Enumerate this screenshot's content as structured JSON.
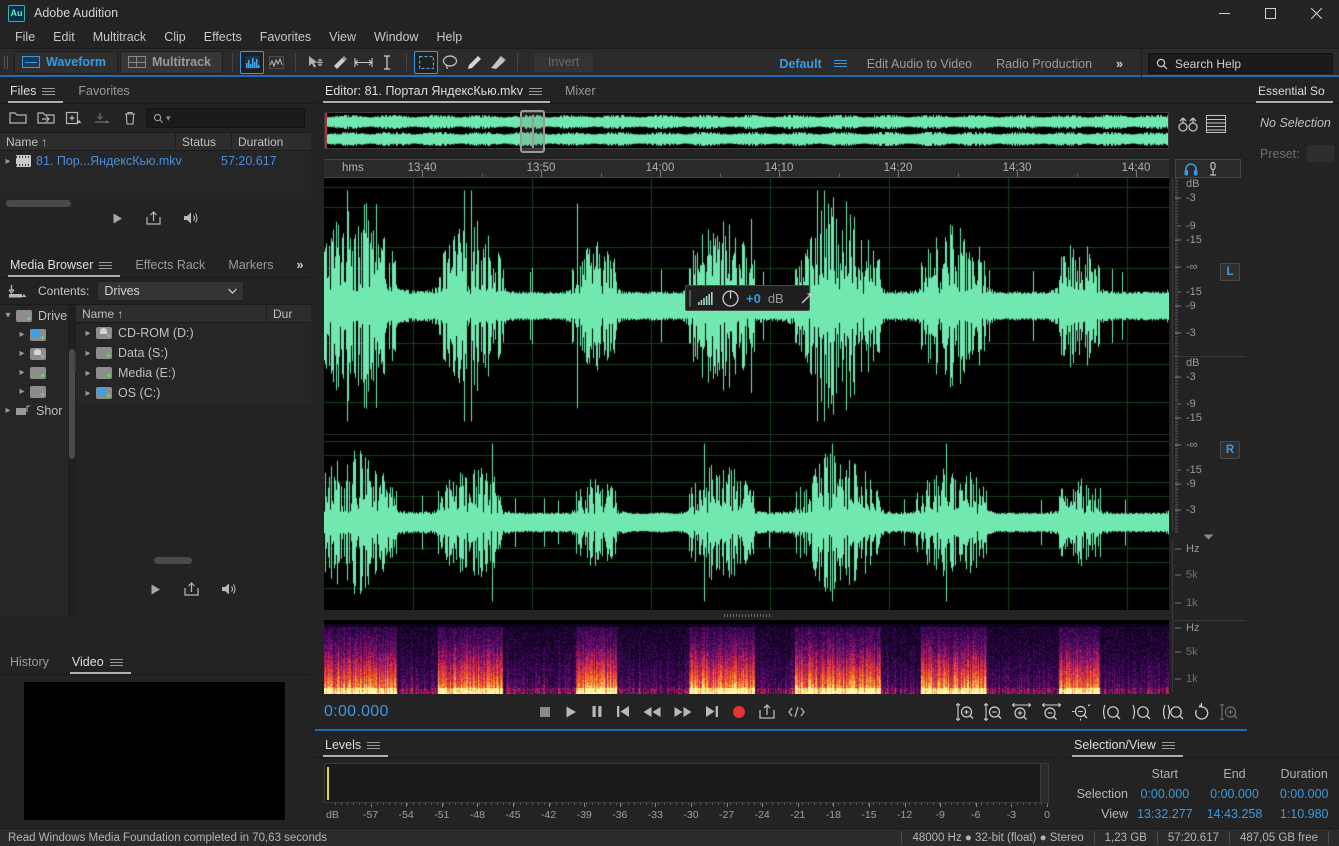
{
  "window": {
    "app_name": "Adobe Audition",
    "logo_text": "Au",
    "minimize": "─",
    "maximize": "□",
    "close": "✕"
  },
  "menubar": {
    "items": [
      "File",
      "Edit",
      "Multitrack",
      "Clip",
      "Effects",
      "Favorites",
      "View",
      "Window",
      "Help"
    ]
  },
  "toolbar": {
    "waveform_label": "Waveform",
    "multitrack_label": "Multitrack",
    "invert_label": "Invert",
    "workspaces": [
      {
        "label": "Default",
        "active": true
      },
      {
        "label": "Edit Audio to Video",
        "active": false
      },
      {
        "label": "Radio Production",
        "active": false
      }
    ],
    "more_label": "»",
    "search_placeholder": "Search Help"
  },
  "files_panel": {
    "tabs": [
      {
        "label": "Files",
        "active": true,
        "menu": true
      },
      {
        "label": "Favorites",
        "active": false,
        "menu": false
      }
    ],
    "search_placeholder": "",
    "columns": [
      "Name ↑",
      "Status",
      "Duration"
    ],
    "rows": [
      {
        "name": "81. Пор...ЯндексКью.mkv",
        "status": "",
        "duration": "57:20.617"
      }
    ]
  },
  "media_browser": {
    "tabs": [
      {
        "label": "Media Browser",
        "active": true,
        "menu": true
      },
      {
        "label": "Effects Rack",
        "active": false,
        "menu": false
      },
      {
        "label": "Markers",
        "active": false,
        "menu": false
      },
      {
        "label": "»",
        "active": false,
        "menu": false
      }
    ],
    "contents_label": "Contents:",
    "contents_value": "Drives",
    "tree": [
      {
        "label": "Drive",
        "icon": "folder-drives-icon",
        "expanded": true
      },
      {
        "label": "",
        "icon": "drive-windows-icon",
        "expanded": false
      },
      {
        "label": "",
        "icon": "drive-cd-icon",
        "expanded": false
      },
      {
        "label": "",
        "icon": "drive-icon",
        "expanded": false
      },
      {
        "label": "",
        "icon": "drive-icon",
        "expanded": false
      },
      {
        "label": "Shor",
        "icon": "shortcuts-icon",
        "expanded": false
      }
    ],
    "columns": [
      "Name ↑",
      "Dur"
    ],
    "rows": [
      {
        "name": "CD-ROM (D:)",
        "icon": "drive-cd-icon"
      },
      {
        "name": "Data (S:)",
        "icon": "drive-icon"
      },
      {
        "name": "Media (E:)",
        "icon": "drive-icon"
      },
      {
        "name": "OS (C:)",
        "icon": "drive-windows-icon"
      }
    ]
  },
  "history_panel": {
    "tabs": [
      {
        "label": "History",
        "active": false,
        "menu": false
      },
      {
        "label": "Video",
        "active": true,
        "menu": true
      }
    ]
  },
  "editor": {
    "tabs": [
      {
        "label": "Editor: 81. Портал ЯндексКью.mkv",
        "active": true,
        "menu": true
      },
      {
        "label": "Mixer",
        "active": false,
        "menu": false
      }
    ],
    "ruler_unit": "hms",
    "ruler_ticks": [
      "13:40",
      "13:50",
      "14:00",
      "14:10",
      "14:20",
      "14:30",
      "14:40"
    ],
    "db_scale_labels": [
      "dB",
      "-3",
      "-9",
      "-15",
      "-∞",
      "-15",
      "-9",
      "-3"
    ],
    "channel_left": "L",
    "channel_right": "R",
    "freq_scale_labels": [
      "Hz",
      "5k",
      "1k"
    ],
    "hud_gain": "+0",
    "hud_unit": "dB",
    "time_display": "0:00.000"
  },
  "levels_panel": {
    "tabs": [
      {
        "label": "Levels",
        "active": true,
        "menu": true
      }
    ],
    "scale_labels": [
      "dB",
      "-57",
      "-54",
      "-51",
      "-48",
      "-45",
      "-42",
      "-39",
      "-36",
      "-33",
      "-30",
      "-27",
      "-24",
      "-21",
      "-18",
      "-15",
      "-12",
      "-9",
      "-6",
      "-3",
      "0"
    ]
  },
  "selection_view": {
    "tabs": [
      {
        "label": "Selection/View",
        "active": true,
        "menu": true
      }
    ],
    "columns": [
      "Start",
      "End",
      "Duration"
    ],
    "rows": [
      {
        "label": "Selection",
        "start": "0:00.000",
        "end": "0:00.000",
        "duration": "0:00.000"
      },
      {
        "label": "View",
        "start": "13:32.277",
        "end": "14:43.258",
        "duration": "1:10.980"
      }
    ]
  },
  "essential_sound": {
    "tabs": [
      {
        "label": "Essential Sо",
        "active": true,
        "menu": false
      }
    ],
    "no_selection": "No Selection",
    "preset_label": "Preset:"
  },
  "statusbar": {
    "message": "Read Windows Media Foundation completed in 70,63 seconds",
    "sample_rate": "48000 Hz ● 32-bit (float) ● Stereo",
    "file_size": "1,23 GB",
    "duration": "57:20.617",
    "free_space": "487,05 GB free"
  },
  "colors": {
    "accent_blue": "#3a9ae0",
    "waveform_green": "#70e8b0",
    "record_red": "#e63232",
    "panel_bg": "#232323",
    "editor_bg": "#000000"
  }
}
